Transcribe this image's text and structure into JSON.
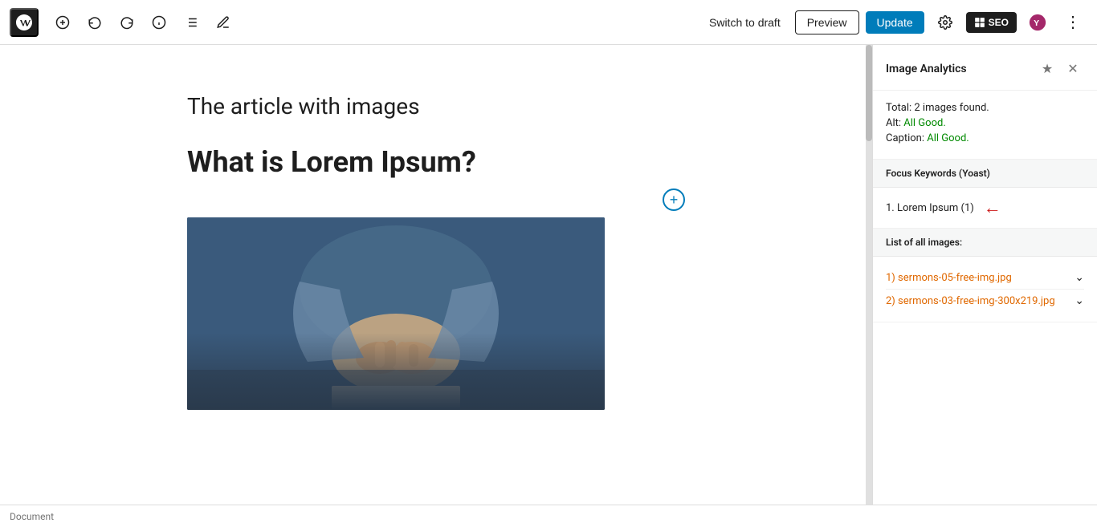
{
  "toolbar": {
    "switch_draft_label": "Switch to draft",
    "preview_label": "Preview",
    "update_label": "Update",
    "seo_label": "SEO",
    "more_options_label": "⋮"
  },
  "editor": {
    "article_title": "The article with images",
    "article_heading": "What is Lorem Ipsum?",
    "add_block_icon": "+"
  },
  "status_bar": {
    "label": "Document"
  },
  "sidebar": {
    "title": "Image Analytics",
    "sections": {
      "analytics": {
        "total_label": "Total: 2 images found.",
        "alt_label": "Alt:",
        "alt_value": "All Good.",
        "caption_label": "Caption:",
        "caption_value": "All Good."
      },
      "focus_keywords": {
        "header": "Focus Keywords (Yoast)",
        "item": "1. Lorem Ipsum (1)"
      },
      "image_list": {
        "header": "List of all images:",
        "items": [
          {
            "id": "1",
            "filename": "1) sermons-05-free-img.jpg"
          },
          {
            "id": "2",
            "filename": "2) sermons-03-free-img-300x219.jpg"
          }
        ]
      }
    }
  },
  "icons": {
    "add": "⊕",
    "undo": "↩",
    "redo": "↪",
    "info": "ℹ",
    "list": "≡",
    "edit": "✏",
    "gear": "⚙",
    "star": "★",
    "close": "✕",
    "chevron_down": "⌄",
    "red_arrow": "←"
  },
  "colors": {
    "update_btn": "#007cba",
    "green": "#008a00",
    "orange": "#e06800",
    "red_arrow": "#cc1818"
  }
}
